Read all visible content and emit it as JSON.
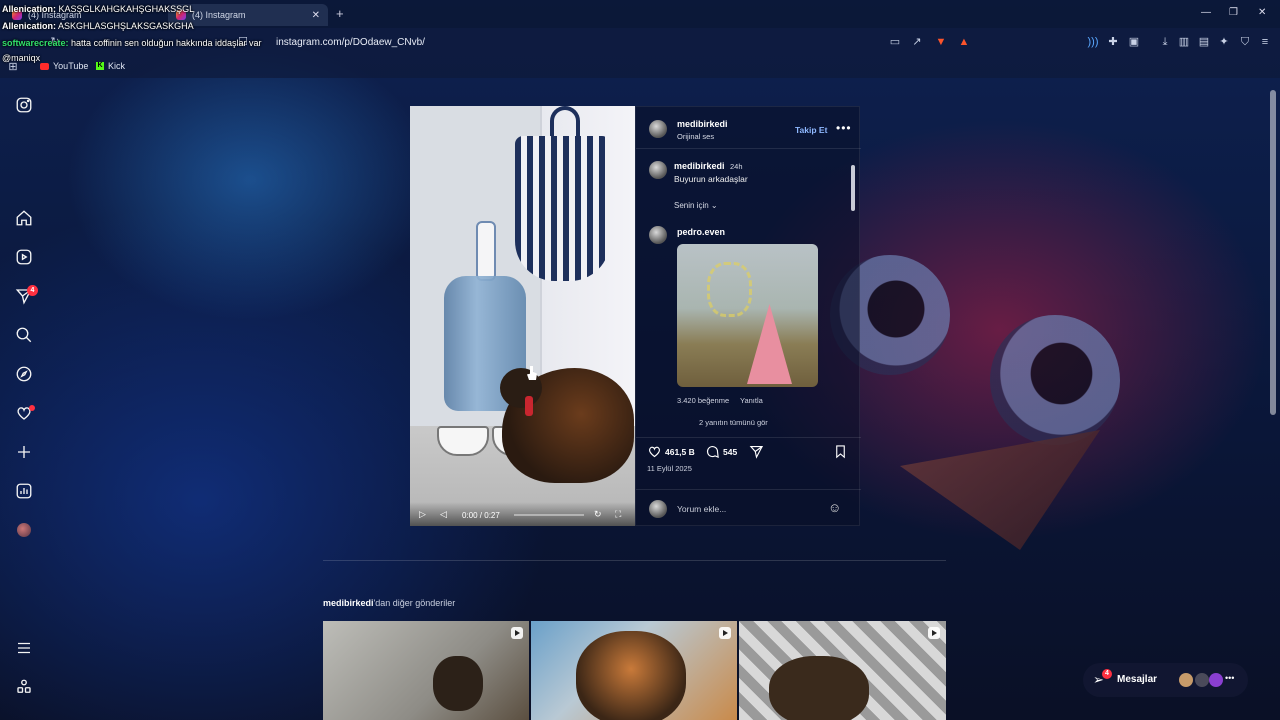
{
  "browser": {
    "tabs": [
      {
        "label": "(4) Instagram",
        "active": false
      },
      {
        "label": "(4) Instagram",
        "active": true
      }
    ],
    "url": "instagram.com/p/DOdaew_CNvb/",
    "bookmarks": [
      "YouTube",
      "Kick"
    ]
  },
  "chat_overlay": [
    {
      "user": "Allenication:",
      "message": "KASŞGLKAHGKAHŞGHAKSŞGL"
    },
    {
      "user": "Allenication:",
      "message": "ASKGHLASGHŞLAKSGASKGHA"
    },
    {
      "user": "softwarecreate:",
      "message": "hatta coffinin sen olduğun hakkında iddaşlar var"
    },
    {
      "user": "",
      "message": "@maniqx"
    }
  ],
  "left_rail": {
    "icons": [
      "instagram-logo-icon",
      "home-icon",
      "reels-icon",
      "direct-icon",
      "search-icon",
      "explore-icon",
      "heart-icon",
      "create-icon",
      "dashboard-icon",
      "profile-avatar",
      "menu-icon",
      "apps-icon"
    ],
    "direct_badge": "4"
  },
  "post": {
    "author": "medibirkedi",
    "audio": "Orijinal ses",
    "follow_label": "Takip Et",
    "caption_author": "medibirkedi",
    "caption_time": "24h",
    "caption_text": "Buyurun arkadaşlar",
    "sort_label": "Senin için",
    "comment_author": "pedro.even",
    "comment_likes": "3.420 beğenme",
    "reply_label": "Yanıtla",
    "view_replies": "2 yanıtın tümünü gör",
    "likes": "461,5 B",
    "comments": "545",
    "date": "11 Eylül 2025",
    "comment_placeholder": "Yorum ekle...",
    "video": {
      "current": "0:00",
      "total": "0:27",
      "time_display": "0:00 / 0:27",
      "progress": 0
    }
  },
  "more_posts": {
    "author": "medibirkedi",
    "suffix": "'dan diğer gönderiler"
  },
  "messages": {
    "label": "Mesajlar",
    "badge": "4"
  },
  "colors": {
    "accent_link": "#8fb8ff",
    "badge": "#ff3040",
    "chat_username": "#31e06b"
  }
}
